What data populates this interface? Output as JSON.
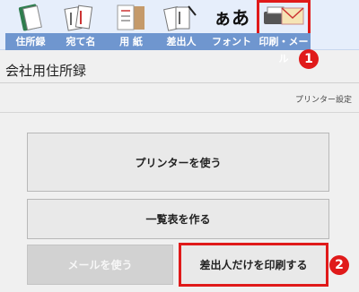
{
  "toolbar": {
    "tabs": [
      {
        "label": "住所録",
        "icon": "address-book-icon"
      },
      {
        "label": "宛て名",
        "icon": "addressee-cards-icon"
      },
      {
        "label": "用 紙",
        "icon": "paper-icon"
      },
      {
        "label": "差出人",
        "icon": "sender-icon"
      },
      {
        "label": "フォント",
        "icon": "font-icon",
        "glyph": "ぁあ"
      },
      {
        "label": "印刷・メール",
        "icon": "print-mail-icon"
      }
    ]
  },
  "callouts": {
    "one": "1",
    "two": "2"
  },
  "page": {
    "title": "会社用住所録",
    "printer_settings": "プリンター設定"
  },
  "buttons": {
    "use_printer": "プリンターを使う",
    "make_list": "一覧表を作る",
    "use_mail": "メールを使う",
    "print_sender_only": "差出人だけを印刷する"
  },
  "colors": {
    "accent": "#e01a1a",
    "toolbar_label_bg": "#6f96cf",
    "toolbar_bg": "#e6eefb"
  }
}
